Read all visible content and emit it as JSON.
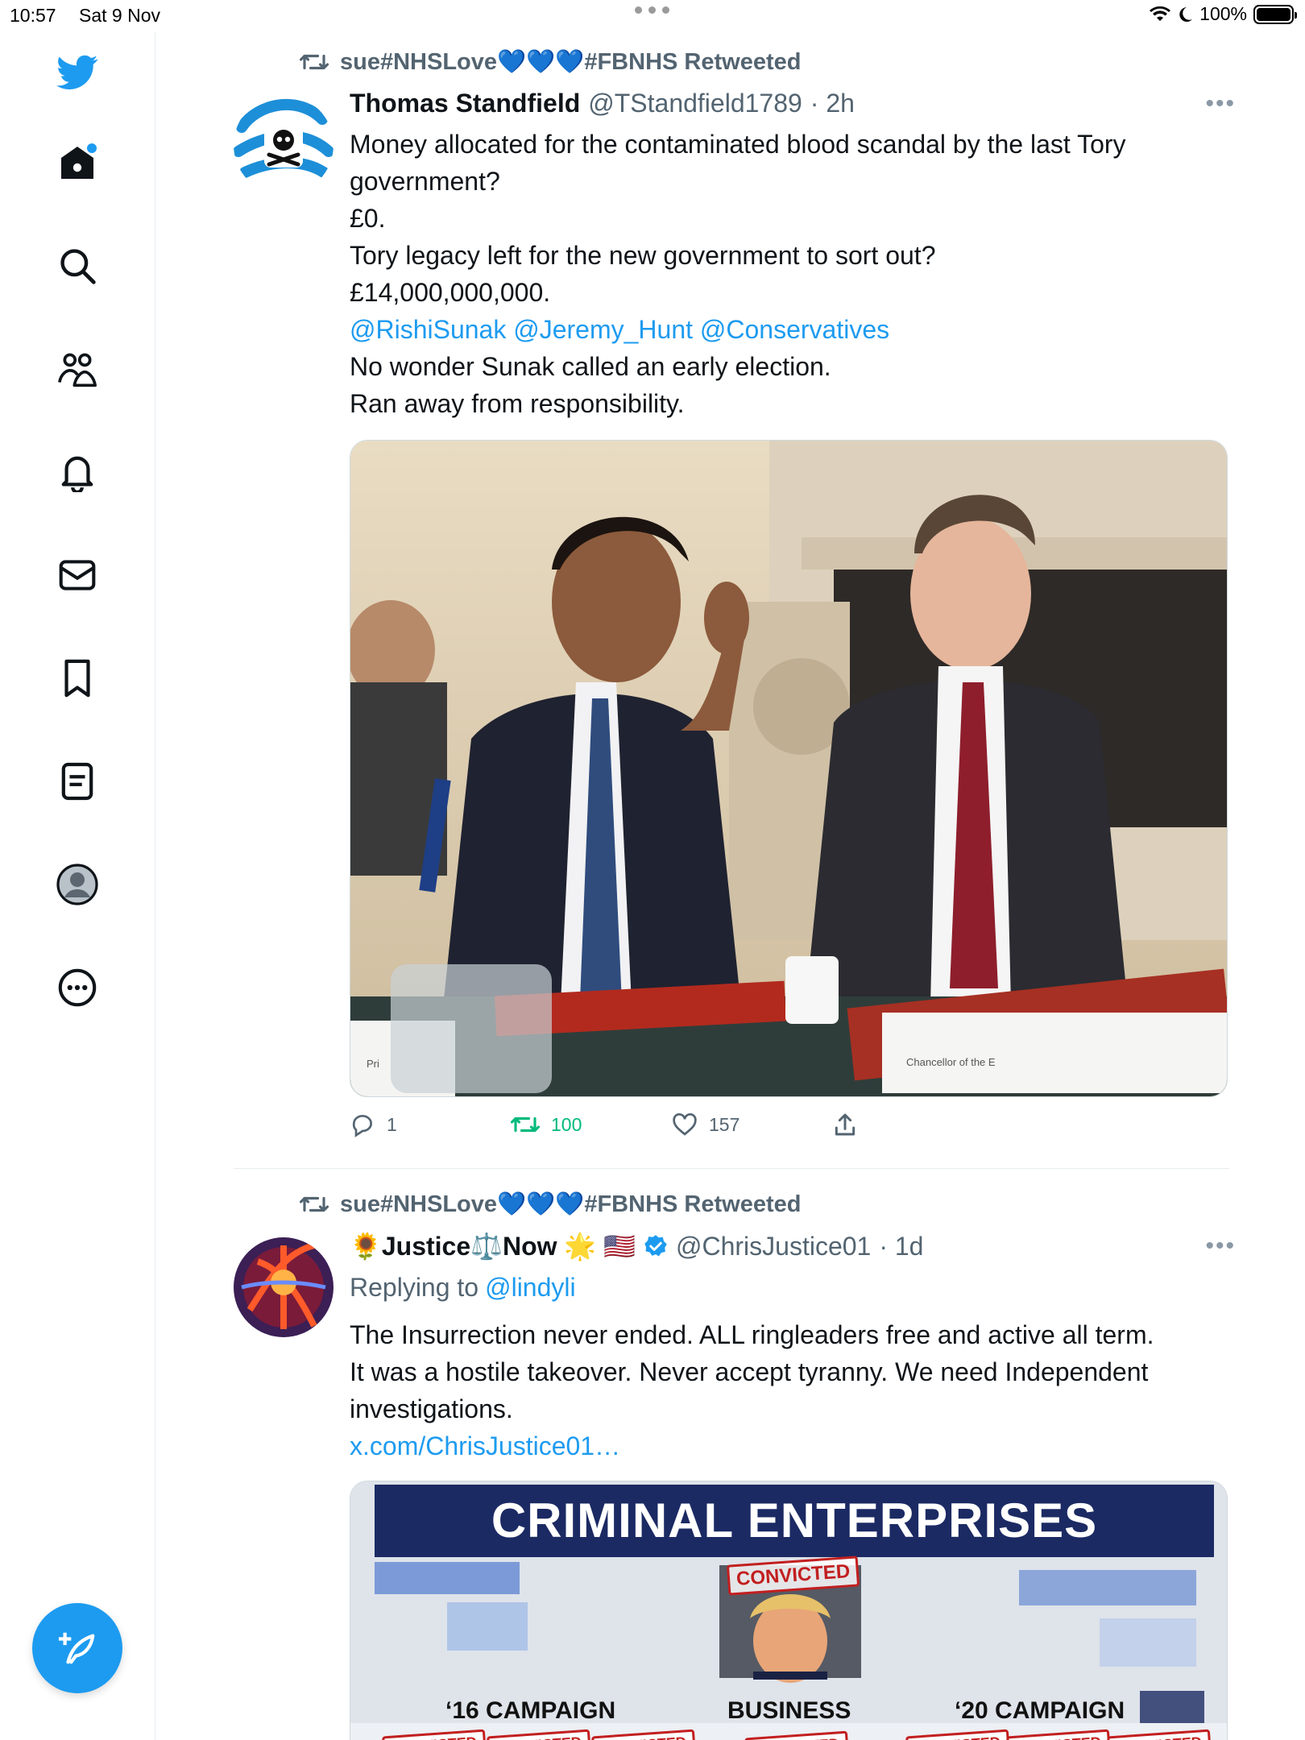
{
  "status_bar": {
    "time": "10:57",
    "date": "Sat 9 Nov",
    "battery": "100%",
    "battery_level": 1.0
  },
  "sidebar": {
    "items": [
      {
        "icon": "twitter-logo-icon"
      },
      {
        "icon": "home-icon"
      },
      {
        "icon": "search-icon"
      },
      {
        "icon": "communities-icon"
      },
      {
        "icon": "notifications-icon"
      },
      {
        "icon": "messages-icon"
      },
      {
        "icon": "bookmarks-icon"
      },
      {
        "icon": "lists-icon"
      },
      {
        "icon": "profile-icon"
      },
      {
        "icon": "more-icon"
      }
    ],
    "compose_icon": "compose-icon"
  },
  "colors": {
    "accent": "#1d9bf0",
    "retweet_green": "#00ba7c",
    "secondary_text": "#536471"
  },
  "tweets": [
    {
      "retweeted_by": "sue#NHSLove💙💙💙#FBNHS Retweeted",
      "name": "Thomas Standfield",
      "handle": "@TStandfield1789",
      "time": "· 2h",
      "lines": [
        "Money allocated for the contaminated blood scandal by the last Tory",
        "government?",
        "£0.",
        "Tory legacy left for the new government to sort out?",
        "£14,000,000,000."
      ],
      "mentions": "@RishiSunak @Jeremy_Hunt @Conservatives",
      "lines_after": [
        "No wonder Sunak called an early election.",
        "Ran away from responsibility."
      ],
      "image_labels": {
        "place_card_left": "Pri",
        "place_card_right": "Chancellor of the E"
      },
      "stats": {
        "replies": "1",
        "retweets": "100",
        "likes": "157"
      }
    },
    {
      "retweeted_by": "sue#NHSLove💙💙💙#FBNHS Retweeted",
      "name": "🌻Justice⚖️Now 🌟 🇺🇸",
      "handle": "@ChrisJustice01",
      "time": "· 1d",
      "replying_prefix": "Replying to",
      "replying_handle": "@lindyli",
      "lines": [
        "The Insurrection never ended. ALL ringleaders free and active all term.",
        "It was a hostile takeover. Never accept tyranny. We need Independent",
        "investigations."
      ],
      "link": "x.com/ChrisJustice01…",
      "graphic": {
        "title": "CRIMINAL ENTERPRISES",
        "stamp": "CONVICTED",
        "labels": [
          "‘16 CAMPAIGN",
          "BUSINESS",
          "‘20 CAMPAIGN"
        ]
      }
    }
  ]
}
